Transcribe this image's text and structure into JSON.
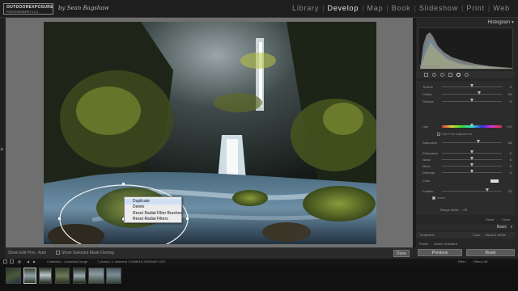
{
  "identity": {
    "logo_line1": "OUTDOOREXPOSURE",
    "logo_line2": "PHOTOGRAPHY LLC",
    "byline": "by Sean Bagshaw"
  },
  "modules": [
    "Library",
    "Develop",
    "Map",
    "Book",
    "Slideshow",
    "Print",
    "Web"
  ],
  "active_module": "Develop",
  "canvas": {
    "background": "#6f6f6f"
  },
  "context_menu": {
    "items": [
      "Duplicate",
      "Delete",
      "Reset Radial Filter Brushes",
      "Reset Radial Filters"
    ],
    "highlighted": "Duplicate"
  },
  "toolbar": {
    "show_edit_pins_label": "Show Edit Pins :",
    "show_edit_pins_value": "Auto",
    "overlay_label": "Show Selected Mask Overlay",
    "done_label": "Done"
  },
  "right_panel": {
    "histogram_title": "Histogram",
    "readout": [
      "f/8",
      "1/8 s",
      "ISO 100",
      "14 mm"
    ],
    "original_photo": "Original Photo",
    "sliders": [
      {
        "label": "Texture",
        "value": "0",
        "pos": 0.5
      },
      {
        "label": "Clarity",
        "value": "30",
        "pos": 0.62
      },
      {
        "label": "Dehaze",
        "value": "0",
        "pos": 0.5
      },
      {
        "label": "Hue",
        "value": "0.0",
        "pos": 0.5,
        "hue": true
      },
      {
        "label": "Saturation",
        "value": "28",
        "pos": 0.6
      },
      {
        "label": "Sharpness",
        "value": "0",
        "pos": 0.5
      },
      {
        "label": "Noise",
        "value": "0",
        "pos": 0.5
      },
      {
        "label": "Moire",
        "value": "0",
        "pos": 0.5
      },
      {
        "label": "Defringe",
        "value": "0",
        "pos": 0.5
      }
    ],
    "use_fine_adjustment": "Use Fine Adjustment",
    "color_label": "Color",
    "feather_label": "Feather",
    "feather_value": "75",
    "invert_label": "Invert",
    "range_mask_label": "Range Mask :",
    "range_mask_value": "Off",
    "reset_label": "Reset",
    "close_label": "Close",
    "basic_title": "Basic",
    "treatment_label": "Treatment :",
    "treatment_color": "Color",
    "treatment_bw": "Black & White",
    "profile_label": "Profile :",
    "profile_value": "Adobe Standard",
    "wb_label": "WB :",
    "wb_value": "Custom",
    "previous_label": "Previous",
    "reset_button_label": "Reset"
  },
  "filmstrip": {
    "collection_label": "Collection : Columbia Gorge",
    "selection_info": "7 photos / 1 selected / 002801S-20090407.CR2",
    "filter_label": "Filter :",
    "filter_value": "Filters Off",
    "page_numbers": [
      "1",
      "2"
    ]
  }
}
